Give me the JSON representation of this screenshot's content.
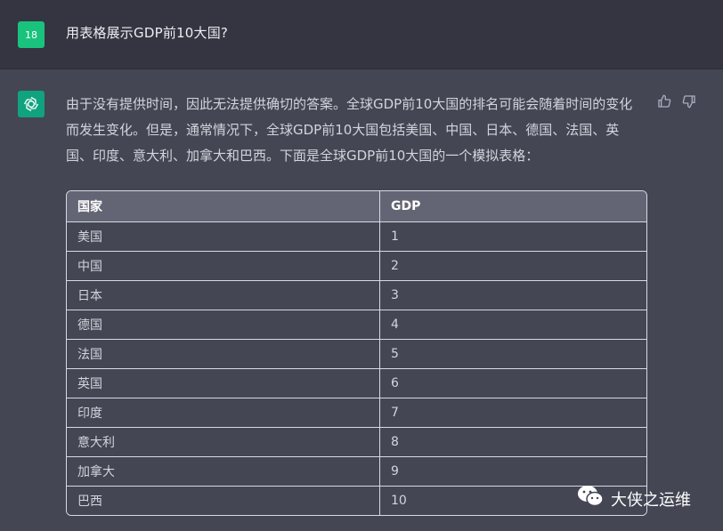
{
  "user_message": {
    "avatar_label": "18",
    "text": "用表格展示GDP前10大国?"
  },
  "assistant_message": {
    "text": "由于没有提供时间，因此无法提供确切的答案。全球GDP前10大国的排名可能会随着时间的变化而发生变化。但是，通常情况下，全球GDP前10大国包括美国、中国、日本、德国、法国、英国、印度、意大利、加拿大和巴西。下面是全球GDP前10大国的一个模拟表格：",
    "table": {
      "headers": [
        "国家",
        "GDP"
      ],
      "rows": [
        [
          "美国",
          "1"
        ],
        [
          "中国",
          "2"
        ],
        [
          "日本",
          "3"
        ],
        [
          "德国",
          "4"
        ],
        [
          "法国",
          "5"
        ],
        [
          "英国",
          "6"
        ],
        [
          "印度",
          "7"
        ],
        [
          "意大利",
          "8"
        ],
        [
          "加拿大",
          "9"
        ],
        [
          "巴西",
          "10"
        ]
      ]
    }
  },
  "icons": {
    "assistant_avatar": "openai-logo-icon",
    "thumbs_up": "thumbs-up-icon",
    "thumbs_down": "thumbs-down-icon",
    "watermark": "wechat-icon"
  },
  "watermark": {
    "text": "大侠之运维"
  },
  "colors": {
    "background": "#444654",
    "user_row_background": "#343541",
    "accent_green": "#10a37f"
  }
}
